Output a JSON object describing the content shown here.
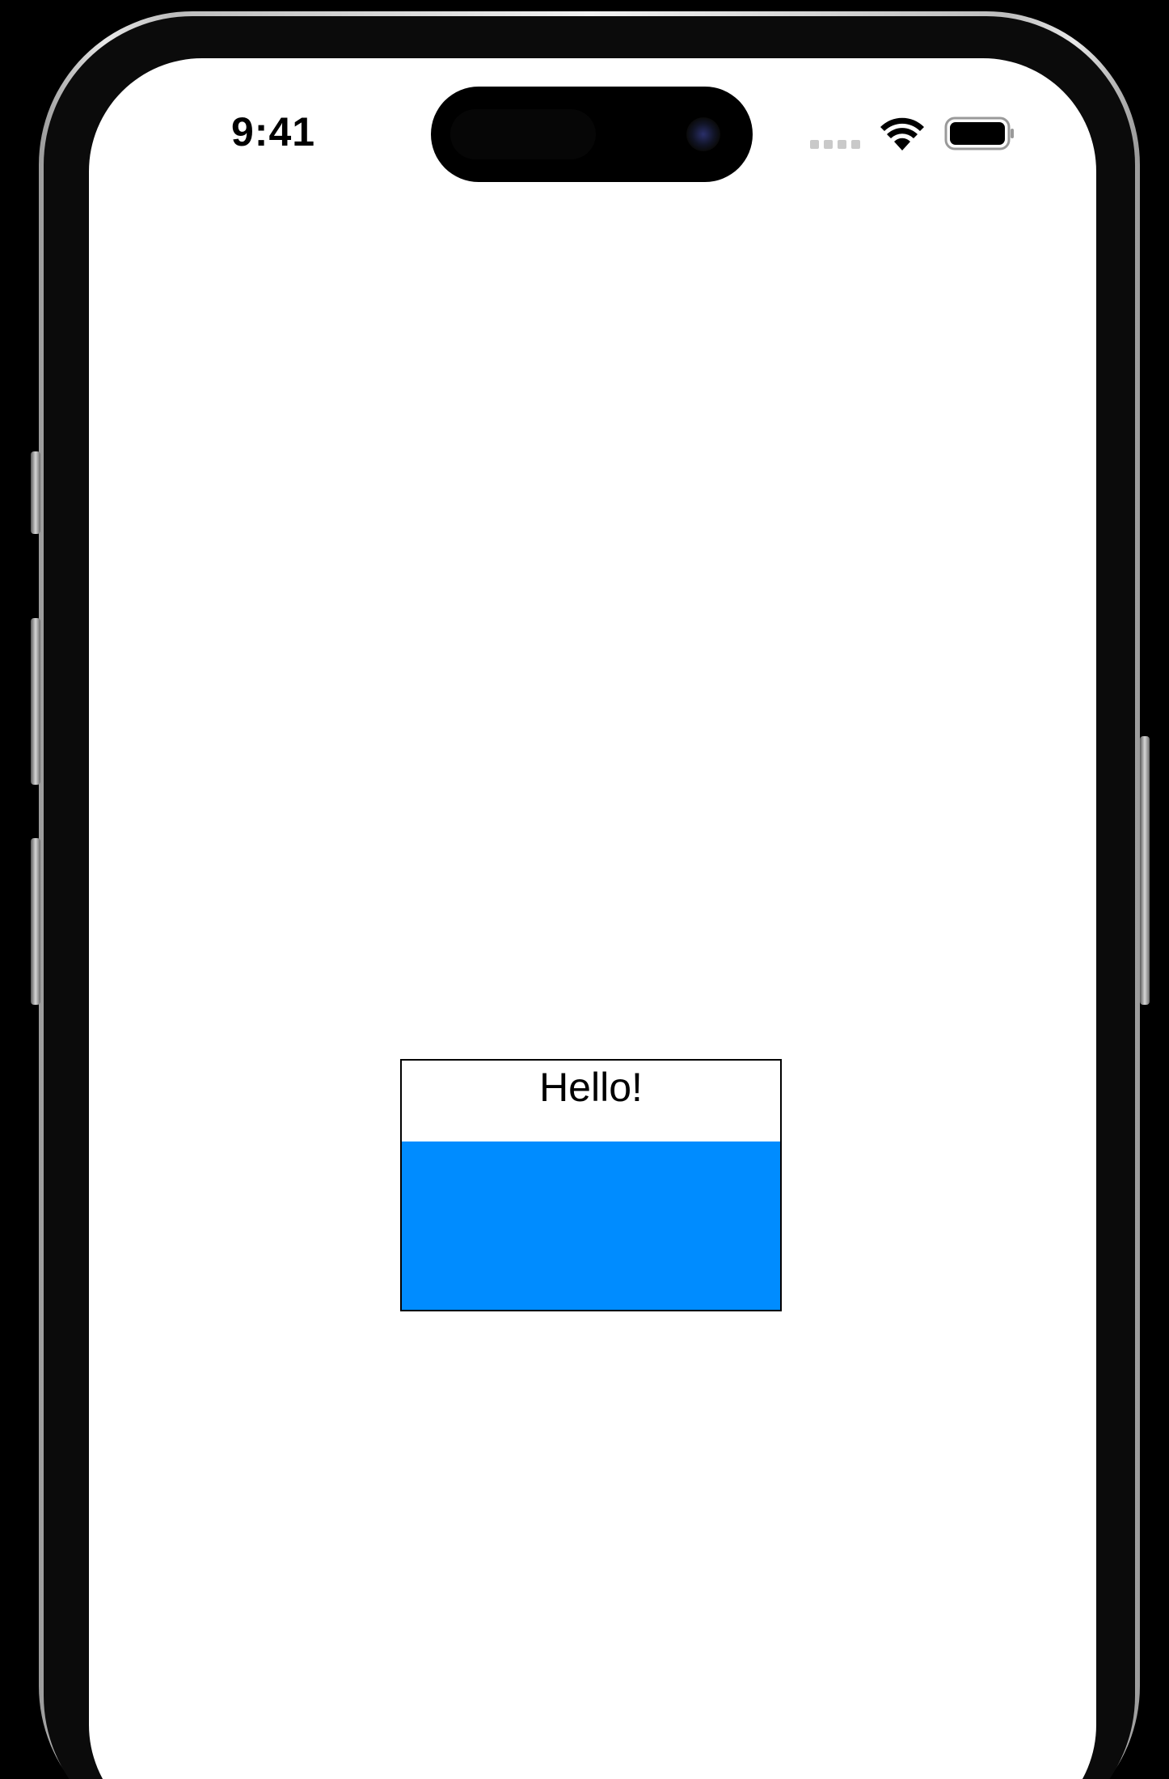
{
  "status_bar": {
    "time": "9:41",
    "signal_icon": "cellular-signal-icon",
    "wifi_icon": "wifi-icon",
    "battery_icon": "battery-icon"
  },
  "content": {
    "greeting": "Hello!",
    "panel_color": "#008CFF",
    "box_border_color": "#000000"
  },
  "colors": {
    "screen_background": "#FFFFFF",
    "frame_background": "#000000",
    "accent_blue": "#008CFF"
  }
}
